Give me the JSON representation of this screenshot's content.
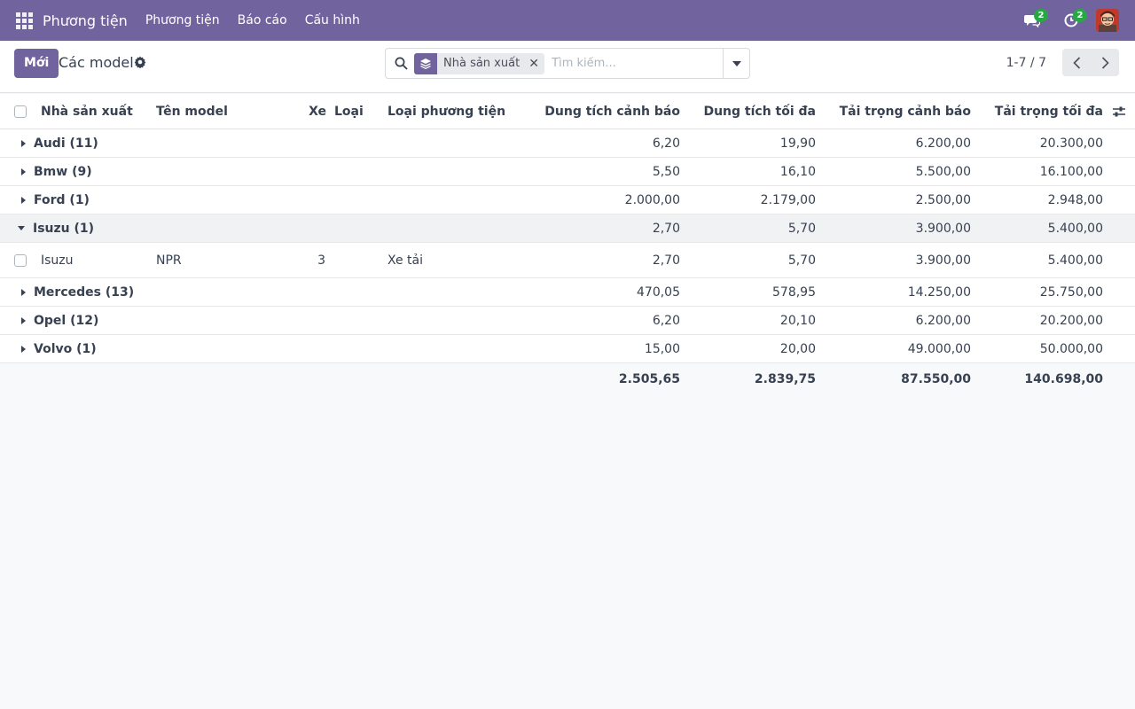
{
  "navbar": {
    "app_name": "Phương tiện",
    "menu": [
      "Phương tiện",
      "Báo cáo",
      "Cấu hình"
    ],
    "messages_badge": "2",
    "activities_badge": "2"
  },
  "control": {
    "new_button": "Mới",
    "breadcrumb": "Các model",
    "facet_label": "Nhà sản xuất",
    "search_placeholder": "Tìm kiếm...",
    "pager": "1-7 / 7"
  },
  "table": {
    "columns": [
      "Nhà sản xuất",
      "Tên model",
      "Xe",
      "Loại",
      "Loại phương tiện",
      "Dung tích cảnh báo",
      "Dung tích tối đa",
      "Tải trọng cảnh báo",
      "Tải trọng tối đa"
    ],
    "groups": [
      {
        "label": "Audi (11)",
        "v1": "6,20",
        "v2": "19,90",
        "v3": "6.200,00",
        "v4": "20.300,00"
      },
      {
        "label": "Bmw (9)",
        "v1": "5,50",
        "v2": "16,10",
        "v3": "5.500,00",
        "v4": "16.100,00"
      },
      {
        "label": "Ford (1)",
        "v1": "2.000,00",
        "v2": "2.179,00",
        "v3": "2.500,00",
        "v4": "2.948,00"
      },
      {
        "label": "Isuzu (1)",
        "v1": "2,70",
        "v2": "5,70",
        "v3": "3.900,00",
        "v4": "5.400,00"
      },
      {
        "label": "Mercedes (13)",
        "v1": "470,05",
        "v2": "578,95",
        "v3": "14.250,00",
        "v4": "25.750,00"
      },
      {
        "label": "Opel (12)",
        "v1": "6,20",
        "v2": "20,10",
        "v3": "6.200,00",
        "v4": "20.200,00"
      },
      {
        "label": "Volvo (1)",
        "v1": "15,00",
        "v2": "20,00",
        "v3": "49.000,00",
        "v4": "50.000,00"
      }
    ],
    "record": {
      "manufacturer": "Isuzu",
      "model": "NPR",
      "vehicles": "3",
      "type": "",
      "vehicle_type": "Xe tải",
      "v1": "2,70",
      "v2": "5,70",
      "v3": "3.900,00",
      "v4": "5.400,00"
    },
    "totals": {
      "v1": "2.505,65",
      "v2": "2.839,75",
      "v3": "87.550,00",
      "v4": "140.698,00"
    }
  },
  "colors": {
    "brand": "#71639e",
    "badge": "#28a745"
  }
}
